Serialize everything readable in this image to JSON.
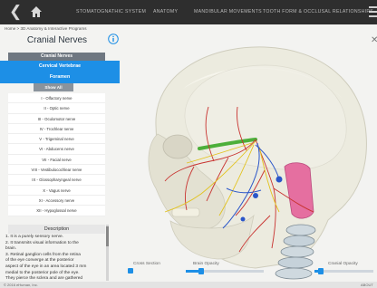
{
  "nav": {
    "items": [
      "STOMATOGNATHIC SYSTEM",
      "ANATOMY",
      "MANDIBULAR MOVEMENTS",
      "TOOTH FORM & OCCLUSAL RELATIONSHIPS"
    ],
    "back_icon": "chevron-left-icon",
    "home_icon": "home-icon",
    "menu_icon": "hamburger-menu-icon"
  },
  "breadcrumb": "Home  >  3D Anatomy & Interactive Programs",
  "panel": {
    "title": "Cranial Nerves",
    "list_header": "Cranial Nerves",
    "selected_items": [
      "Cervical Vertebrae",
      "Foramen"
    ],
    "show_all": "Show All",
    "nerves": [
      "I - Olfactory nerve",
      "II - Optic nerve",
      "III - Oculomotor nerve",
      "IV - Trochlear nerve",
      "V - Trigeminal nerve",
      "VI - Abducens nerve",
      "VII - Facial nerve",
      "VIII - Vestibulocochlear nerve",
      "IX - Glossopharyngeal nerve",
      "X - Vagus nerve",
      "XI - Accessory nerve",
      "XII - Hypoglossal nerve"
    ]
  },
  "description": {
    "title": "Description",
    "lines": [
      "1.  It is a purely sensory nerve.",
      "2.  It transmits visual information to the",
      "brain.",
      "3.  Retinal ganglion cells from the retina",
      "of the eye converge at the posterior",
      "aspect of the eye in an area located 3 mm",
      "medial to the posterior pole of the eye.",
      "They pierce the sclera and are gathered"
    ]
  },
  "controls": {
    "cross_section": "Cross Section",
    "brain_opacity": "Brain Opacity",
    "cranial_opacity": "Cranial Opacity",
    "brain_opacity_value": 0.2,
    "cranial_opacity_value": 0.1
  },
  "footer": {
    "copyright": "© 2016 eHuman, Inc.",
    "right": "ABOUT"
  },
  "colors": {
    "accent": "#1d8fe6",
    "topbar": "#2e2e2e",
    "header_gray": "#6f7781"
  }
}
